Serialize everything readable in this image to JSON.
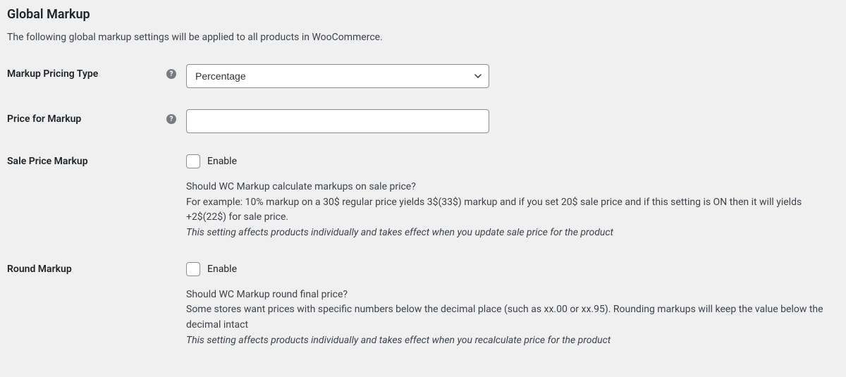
{
  "section": {
    "title": "Global Markup",
    "description": "The following global markup settings will be applied to all products in WooCommerce."
  },
  "fields": {
    "pricing_type": {
      "label": "Markup Pricing Type",
      "value": "Percentage",
      "help_glyph": "?"
    },
    "price_markup": {
      "label": "Price for Markup",
      "value": "",
      "placeholder": "",
      "help_glyph": "?"
    },
    "sale_price_markup": {
      "label": "Sale Price Markup",
      "enable_label": "Enable",
      "desc_line1": "Should WC Markup calculate markups on sale price?",
      "desc_line2": "For example: 10% markup on a 30$ regular price yields 3$(33$) markup and if you set 20$ sale price and if this setting is ON then it will yields +2$(22$) for sale price.",
      "desc_italic": "This setting affects products individually and takes effect when you update sale price for the product"
    },
    "round_markup": {
      "label": "Round Markup",
      "enable_label": "Enable",
      "desc_line1": "Should WC Markup round final price?",
      "desc_line2": "Some stores want prices with specific numbers below the decimal place (such as xx.00 or xx.95). Rounding markups will keep the value below the decimal intact",
      "desc_italic": "This setting affects products individually and takes effect when you recalculate price for the product"
    }
  }
}
